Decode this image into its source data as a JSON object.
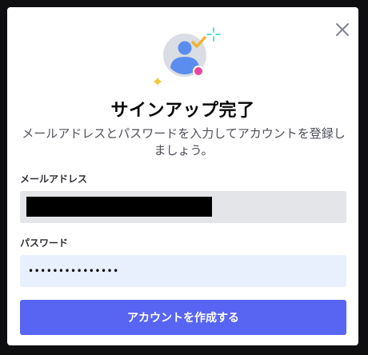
{
  "modal": {
    "title": "サインアップ完了",
    "subtitle": "メールアドレスとパスワードを入力してアカウントを登録しましょう。"
  },
  "form": {
    "email_label": "メールアドレス",
    "password_label": "パスワード",
    "password_value": "•••••••••••••••",
    "submit_label": "アカウントを作成する"
  },
  "colors": {
    "accent": "#5865f2",
    "avatar_blue": "#5b8def",
    "check_orange": "#f0b232",
    "dot_pink": "#eb459e",
    "sparkle_teal": "#23d4c0",
    "sparkle_yellow": "#f7c632"
  },
  "icons": {
    "close": "close-icon",
    "hero": "user-avatar-illustration",
    "check": "check-icon",
    "sparkle": "sparkle-icon"
  }
}
